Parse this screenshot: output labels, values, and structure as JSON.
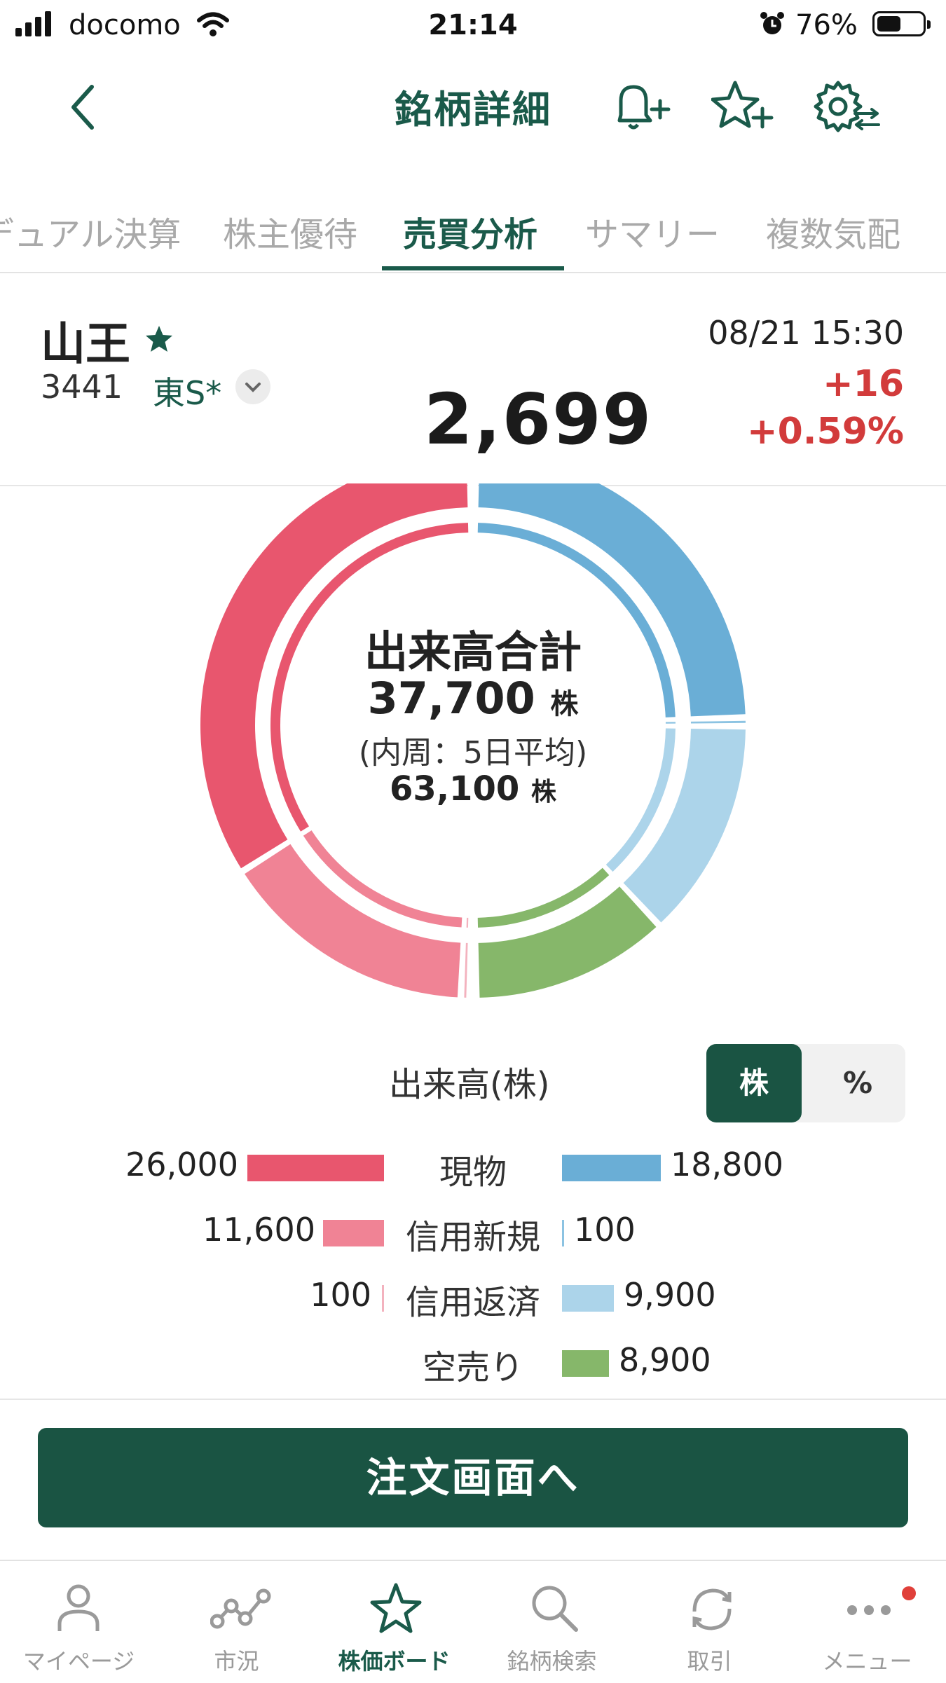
{
  "status_bar": {
    "carrier": "docomo",
    "time": "21:14",
    "battery": "76%",
    "battery_level": 0.76
  },
  "header": {
    "title": "銘柄詳細",
    "icons": [
      "back-chevron-icon",
      "bell-plus-icon",
      "star-plus-icon",
      "gear-sliders-icon"
    ]
  },
  "tabs": [
    {
      "label": "デュアル決算",
      "active": false
    },
    {
      "label": "株主優待",
      "active": false
    },
    {
      "label": "売買分析",
      "active": true
    },
    {
      "label": "サマリー",
      "active": false
    },
    {
      "label": "複数気配",
      "active": false
    }
  ],
  "stock": {
    "name": "山王",
    "code": "3441",
    "market": "東S*",
    "datetime": "08/21 15:30",
    "change": "+16",
    "change_pct": "+0.59%",
    "price": "2,699"
  },
  "donut": {
    "title": "出来高合計",
    "total": "37,700",
    "unit": "株",
    "inner_label": "(内周：5日平均)",
    "avg": "63,100",
    "outer": [
      {
        "side": "buy",
        "name": "現物",
        "value": 26000,
        "color": "#e8566e"
      },
      {
        "side": "buy",
        "name": "信用新規",
        "value": 11600,
        "color": "#f08395"
      },
      {
        "side": "buy",
        "name": "信用返済",
        "value": 100,
        "color": "#f3b2be"
      },
      {
        "side": "sell",
        "name": "現物",
        "value": 18800,
        "color": "#6aaed6"
      },
      {
        "side": "sell",
        "name": "信用新規",
        "value": 100,
        "color": "#8cc3e2"
      },
      {
        "side": "sell",
        "name": "信用返済",
        "value": 9900,
        "color": "#acd4ea"
      },
      {
        "side": "sell",
        "name": "空売り",
        "value": 8900,
        "color": "#86b76a"
      }
    ]
  },
  "legend": {
    "title": "出来高(株)",
    "toggle": [
      "株",
      "%"
    ],
    "rows": [
      {
        "label": "現物",
        "buy": "26,000",
        "sell": "18,800",
        "buy_value": 26000,
        "sell_value": 18800
      },
      {
        "label": "信用新規",
        "buy": "11,600",
        "sell": "100",
        "buy_value": 11600,
        "sell_value": 100
      },
      {
        "label": "信用返済",
        "buy": "100",
        "sell": "9,900",
        "buy_value": 100,
        "sell_value": 9900
      },
      {
        "label": "空売り",
        "buy": "",
        "sell": "8,900",
        "buy_value": 0,
        "sell_value": 8900
      }
    ]
  },
  "order_button": {
    "label": "注文画面へ"
  },
  "tabbar": [
    {
      "label": "マイページ",
      "icon": "person-icon",
      "active": false
    },
    {
      "label": "市況",
      "icon": "market-chart-icon",
      "active": false
    },
    {
      "label": "株価ボード",
      "icon": "star-icon",
      "active": true
    },
    {
      "label": "銘柄検索",
      "icon": "search-icon",
      "active": false
    },
    {
      "label": "取引",
      "icon": "refresh-icon",
      "active": false
    },
    {
      "label": "メニュー",
      "icon": "more-icon",
      "active": false
    }
  ]
}
